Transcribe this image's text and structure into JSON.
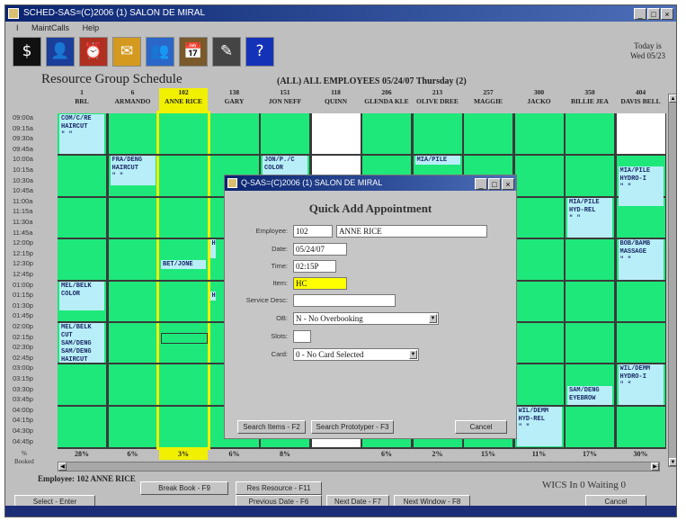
{
  "window": {
    "title": "SCHED-SAS=(C)2006 (1) SALON DE MIRAL",
    "controls": [
      "_",
      "□",
      "×"
    ]
  },
  "menu": [
    "I",
    "MaintCalls",
    "Help"
  ],
  "toolbar_icons": [
    {
      "name": "dollar-icon",
      "glyph": "$",
      "bg": "#111111"
    },
    {
      "name": "person-icon",
      "glyph": "👤",
      "bg": "#1b3e9a"
    },
    {
      "name": "clock-icon",
      "glyph": "⏰",
      "bg": "#b03020"
    },
    {
      "name": "envelope-icon",
      "glyph": "✉",
      "bg": "#d49a20"
    },
    {
      "name": "group-icon",
      "glyph": "👥",
      "bg": "#2a67c8"
    },
    {
      "name": "calendar-icon",
      "glyph": "📅",
      "bg": "#7a5a2a"
    },
    {
      "name": "pen-icon",
      "glyph": "✎",
      "bg": "#444444"
    },
    {
      "name": "help-icon",
      "glyph": "?",
      "bg": "#1432b8"
    }
  ],
  "today": {
    "label": "Today is",
    "value": "Wed 05/23"
  },
  "schedule": {
    "title": "Resource Group Schedule",
    "caption": "(ALL) ALL EMPLOYEES    05/24/07 Thursday  (2)",
    "columns": [
      {
        "num": "1",
        "name": "BRL"
      },
      {
        "num": "6",
        "name": "ARMANDO"
      },
      {
        "num": "102",
        "name": "ANNE RICE"
      },
      {
        "num": "138",
        "name": "GARY"
      },
      {
        "num": "151",
        "name": "JON NEFF"
      },
      {
        "num": "118",
        "name": "QUINN"
      },
      {
        "num": "206",
        "name": "GLENDA KLE"
      },
      {
        "num": "213",
        "name": "OLIVE DREE"
      },
      {
        "num": "257",
        "name": "MAGGIE"
      },
      {
        "num": "300",
        "name": "JACKO"
      },
      {
        "num": "350",
        "name": "BILLIE JEA"
      },
      {
        "num": "404",
        "name": "DAVIS BELL"
      }
    ],
    "times": [
      "09:00a",
      "09:15a",
      "09:30a",
      "09:45a",
      "10:00a",
      "10:15a",
      "10:30a",
      "10:45a",
      "11:00a",
      "11:15a",
      "11:30a",
      "11:45a",
      "12:00p",
      "12:15p",
      "12:30p",
      "12:45p",
      "01:00p",
      "01:15p",
      "01:30p",
      "01:45p",
      "02:00p",
      "02:15p",
      "02:30p",
      "02:45p",
      "03:00p",
      "03:15p",
      "03:30p",
      "03:45p",
      "04:00p",
      "04:15p",
      "04:30p",
      "04:45p"
    ],
    "appointments": [
      {
        "col": 0,
        "start": 0,
        "len": 4,
        "text": "COM/C/RE\nHAIRCUT\n\" \""
      },
      {
        "col": 1,
        "start": 4,
        "len": 3,
        "text": "FRA/DENG\nHAIRCUT\n\" \""
      },
      {
        "col": 4,
        "start": 4,
        "len": 2,
        "text": "JON/P./C\nCOLOR"
      },
      {
        "col": 7,
        "start": 4,
        "len": 1,
        "text": "MIA/PILE"
      },
      {
        "col": 11,
        "start": 5,
        "len": 4,
        "text": "MIA/PILE\nHYDRO-I\n\" \""
      },
      {
        "col": 10,
        "start": 8,
        "len": 4,
        "text": "MIA/PILE\nHYD-REL\n\" \""
      },
      {
        "col": 11,
        "start": 12,
        "len": 4,
        "text": "BOB/BAMB\nMASSAGE\n\" \""
      },
      {
        "col": 3,
        "start": 12,
        "len": 2,
        "text": "H"
      },
      {
        "col": 2,
        "start": 14,
        "len": 1,
        "text": "BET/JONE"
      },
      {
        "col": 3,
        "start": 17,
        "len": 1,
        "text": "H"
      },
      {
        "col": 0,
        "start": 16,
        "len": 3,
        "text": "MEL/BELK\nCOLOR"
      },
      {
        "col": 0,
        "start": 20,
        "len": 4,
        "text": "MEL/BELK\nCUT\nSAM/DENG\nSAM/DENG\nHAIRCUT"
      },
      {
        "col": 11,
        "start": 24,
        "len": 4,
        "text": "WIL/DEMM\nHYDRO-I\n\" \""
      },
      {
        "col": 10,
        "start": 26,
        "len": 2,
        "text": "SAM/DENG\nEYEBROW"
      },
      {
        "col": 9,
        "start": 28,
        "len": 4,
        "text": "WIL/DEMM\nHYD-REL\n\" \""
      }
    ],
    "white_columns": [
      5,
      11
    ],
    "white_ranges": [
      {
        "col": 11,
        "start": 0,
        "len": 4
      }
    ],
    "percents": [
      "28%",
      "6%",
      "3%",
      "6%",
      "8%",
      "",
      "6%",
      "2%",
      "15%",
      "11%",
      "17%",
      "30%"
    ],
    "booked_label": "%\nBooked"
  },
  "status": {
    "employee": "Employee: 102   ANNE RICE",
    "counts": "WICS In 0  Waiting 0"
  },
  "buttons": {
    "break_book": "Break Book - F9",
    "res_resource": "Res Resource - F11",
    "select": "Select - Enter",
    "prev_date": "Previous Date - F6",
    "next_date": "Next Date - F7",
    "next_window": "Next Window - F8",
    "cancel": "Cancel"
  },
  "dialog": {
    "title": "Q-SAS=(C)2006 (1) SALON DE MIRAL",
    "heading": "Quick Add Appointment",
    "employee_label": "Employee:",
    "employee_num": "102",
    "employee_name": "ANNE RICE",
    "date_label": "Date:",
    "date_value": "05/24/07",
    "time_label": "Time:",
    "time_value": "02:15P",
    "item_label": "Item:",
    "item_value": "HC",
    "service_label": "Service Desc:",
    "service_value": "",
    "ob_label": "OB:",
    "ob_value": "N - No Overbooking",
    "slots_label": "Slots:",
    "slots_value": "",
    "card_label": "Card:",
    "card_value": "0 - No Card Selected",
    "btn_search_items": "Search Items - F2",
    "btn_search_protyper": "Search Prototyper - F3",
    "btn_cancel": "Cancel"
  }
}
